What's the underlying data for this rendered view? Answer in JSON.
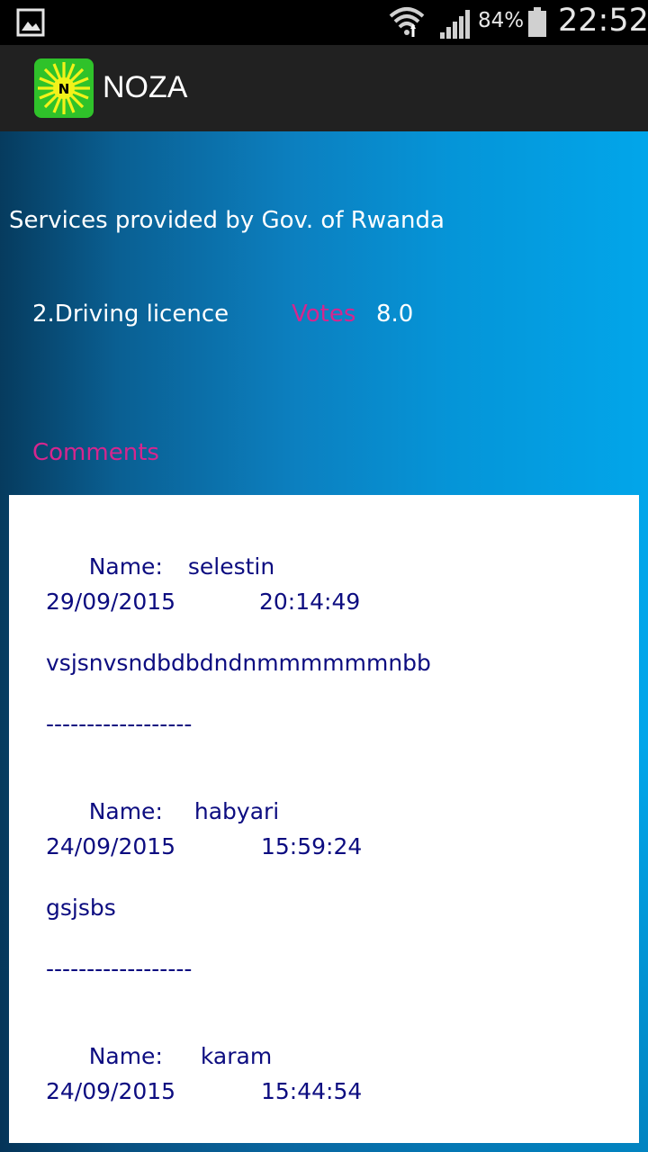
{
  "status_bar": {
    "battery_percent": "84%",
    "time": "22:52",
    "icons": [
      "gallery-icon",
      "wifi-icon",
      "signal-icon",
      "battery-icon"
    ]
  },
  "action_bar": {
    "logo_letter": "N",
    "title": "NOZA"
  },
  "page": {
    "services_title": "Services provided by Gov. of Rwanda",
    "service_name": "2.Driving licence",
    "votes_label": "Votes",
    "votes_value": "8.0",
    "comments_label": "Comments"
  },
  "comments": [
    {
      "name_label": "Name:",
      "name": "selestin",
      "date": "29/09/2015",
      "time": "20:14:49",
      "text": "vsjsnvsndbdbdndnmmmmmmnbb",
      "separator": "------------------"
    },
    {
      "name_label": "Name:",
      "name": "habyari",
      "date": "24/09/2015",
      "time": "15:59:24",
      "text": "gsjsbs",
      "separator": "------------------"
    },
    {
      "name_label": "Name:",
      "name": "karam",
      "date": "24/09/2015",
      "time": "15:44:54"
    }
  ],
  "colors": {
    "accent_pink": "#d6268e",
    "comment_text": "#0c0c80",
    "action_bar": "#212121",
    "logo_green": "#2fc22a",
    "logo_yellow": "#f2f21a"
  }
}
